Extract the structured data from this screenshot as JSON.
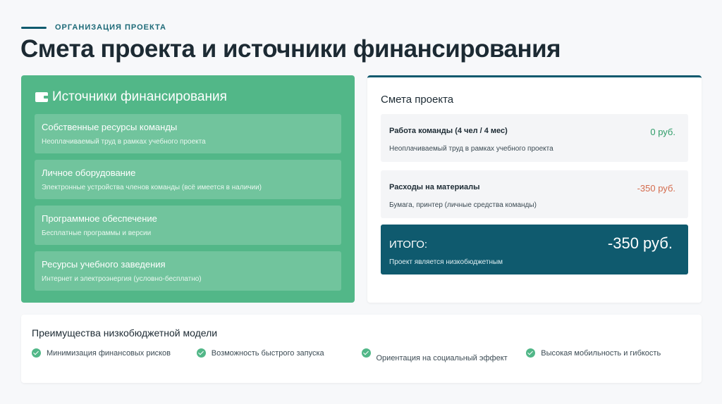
{
  "header": {
    "eyebrow": "ОРГАНИЗАЦИЯ ПРОЕКТА",
    "title": "Смета проекта и источники финансирования"
  },
  "funding": {
    "icon": "wallet-icon",
    "title": "Источники финансирования",
    "items": [
      {
        "name": "Собственные ресурсы команды",
        "desc": "Неоплачиваемый труд в рамках учебного проекта"
      },
      {
        "name": "Личное оборудование",
        "desc": "Электронные устройства членов команды (всё имеется в наличии)"
      },
      {
        "name": "Программное обеспечение",
        "desc": "Бесплатные программы и версии"
      },
      {
        "name": "Ресурсы учебного заведения",
        "desc": "Интернет и электроэнергия (условно-бесплатно)"
      }
    ]
  },
  "estimate": {
    "title": "Смета проекта",
    "items": [
      {
        "name": "Работа команды (4 чел / 4 мес)",
        "desc": "Неоплачиваемый труд в рамках учебного проекта",
        "amount": "0 руб."
      },
      {
        "name": "Расходы на материалы",
        "desc": "Бумага, принтер (личные средства команды)",
        "amount": "-350 руб."
      }
    ],
    "total": {
      "label": "ИТОГО:",
      "sum": "-350 руб.",
      "note": "Проект является низкобюджетным"
    }
  },
  "benefits": {
    "title": "Преимущества низкобюджетной модели",
    "items": [
      "Минимизация финансовых рисков",
      "Возможность быстрого запуска",
      "Ориентация на социальный эффект",
      "Высокая мобильность и гибкость"
    ]
  },
  "colors": {
    "accent_dark": "#0f5a6e",
    "accent_green": "#52b788",
    "amount_positive": "#2e9c68",
    "amount_negative": "#d46c4e"
  }
}
